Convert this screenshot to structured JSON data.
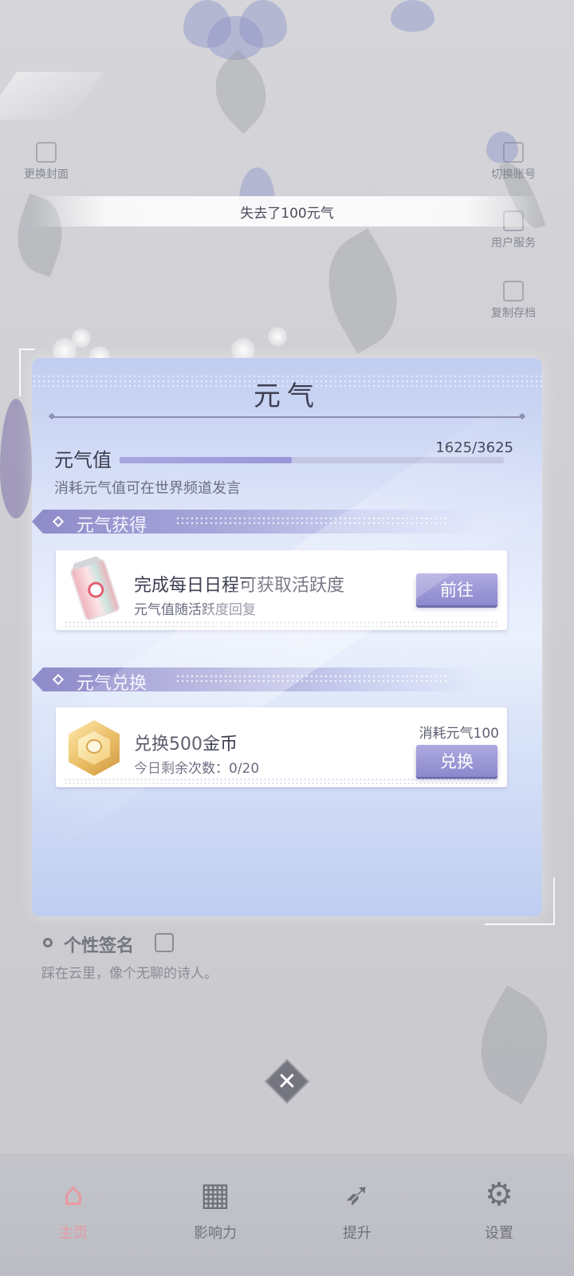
{
  "background": {
    "left_labels": [
      "更换封面"
    ],
    "right_labels": [
      "切换账号",
      "用户服务",
      "复制存档"
    ]
  },
  "toast": {
    "text": "失去了100元气"
  },
  "panel": {
    "title": "元气",
    "vitality": {
      "label": "元气值",
      "value_text": "1625/3625",
      "current": 1625,
      "max": 3625,
      "note": "消耗元气值可在世界频道发言"
    },
    "section_gain": {
      "title": "元气获得",
      "card": {
        "icon": "soda-can-icon",
        "title": "完成每日日程可获取活跃度",
        "subtitle": "元气值随活跃度回复",
        "button": "前往"
      }
    },
    "section_exchange": {
      "title": "元气兑换",
      "card": {
        "icon": "gold-coin-icon",
        "title": "兑换500金币",
        "subtitle": "今日剩余次数：0/20",
        "cost": "消耗元气100",
        "button": "兑换"
      }
    }
  },
  "profile": {
    "signature_title": "个性签名",
    "signature_text": "踩在云里，像个无聊的诗人。"
  },
  "close": {
    "icon": "close-icon"
  },
  "nav": {
    "items": [
      {
        "label": "主页",
        "icon": "home-icon",
        "active": true
      },
      {
        "label": "影响力",
        "icon": "grid-icon",
        "active": false
      },
      {
        "label": "提升",
        "icon": "rocket-icon",
        "active": false
      },
      {
        "label": "设置",
        "icon": "gear-icon",
        "active": false
      }
    ]
  },
  "colors": {
    "accent": "#9a96d8",
    "panel_top": "#c0cdf0",
    "nav_active": "#e79aa2"
  }
}
